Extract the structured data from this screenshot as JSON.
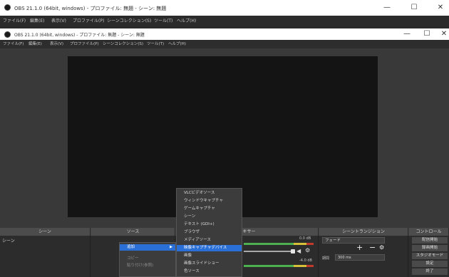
{
  "outer_window": {
    "title": "OBS 21.1.0 (64bit, windows) - プロファイル: 無題 - シーン: 無題",
    "controls": {
      "minimize": "—",
      "maximize": "☐",
      "close": "✕"
    }
  },
  "outer_menu": [
    "ファイル(F)",
    "編集(E)",
    "表示(V)",
    "プロファイル(P)",
    "シーンコレクション(S)",
    "ツール(T)",
    "ヘルプ(H)"
  ],
  "inner_window": {
    "title": "OBS 21.1.0 (64bit, windows) - プロファイル: 無題 - シーン: 無題",
    "controls": {
      "minimize": "—",
      "maximize": "☐",
      "close": "✕"
    }
  },
  "inner_menu": [
    "ファイル(F)",
    "編集(E)",
    "表示(V)",
    "プロファイル(P)",
    "シーンコレクション(S)",
    "ツール(T)",
    "ヘルプ(H)"
  ],
  "docks": {
    "scenes": {
      "header": "シーン",
      "items": [
        "シーン"
      ]
    },
    "sources": {
      "header": "ソース"
    },
    "mixer": {
      "header": "ミキサー",
      "db1": "0.0 dB",
      "db2": "-4.0 dB"
    },
    "transitions": {
      "header": "シーントランジション",
      "type": "フェード",
      "duration_label": "期間",
      "duration_value": "300 ms"
    },
    "controls": {
      "header": "コントロール",
      "buttons": [
        "配信開始",
        "録画開始",
        "スタジオモード",
        "設定",
        "終了"
      ]
    }
  },
  "source_context_menu": {
    "items": [
      "追加",
      "コピー",
      "貼り付け(参照)"
    ]
  },
  "add_submenu": {
    "items": [
      "VLCビデオソース",
      "ウィンドウキャプチャ",
      "ゲームキャプチャ",
      "シーン",
      "テキスト (GDI+)",
      "ブラウザ",
      "メディアソース",
      "映像キャプチャデバイス",
      "画像",
      "画像スライドショー",
      "色ソース"
    ],
    "highlighted": "映像キャプチャデバイス"
  },
  "colors": {
    "highlight": "#2a6fd6",
    "meter_green": "#4caf50",
    "meter_yellow": "#d6c03a",
    "meter_red": "#c0392b"
  }
}
